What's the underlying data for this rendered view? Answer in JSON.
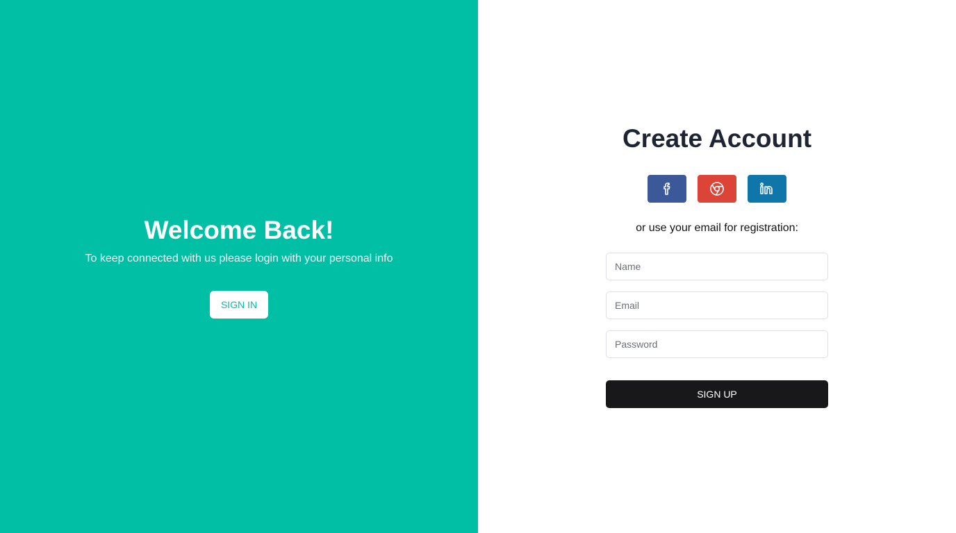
{
  "colors": {
    "left_panel_bg": "#00bfa5",
    "facebook": "#3b5998",
    "google": "#db4437",
    "linkedin": "#0e76a8",
    "signup_bg": "#18181b",
    "title_text": "#1f2433"
  },
  "left": {
    "title": "Welcome Back!",
    "subtitle": "To keep connected with us please login with your personal info",
    "signin_label": "SIGN IN"
  },
  "right": {
    "title": "Create Account",
    "social": [
      {
        "icon": "facebook-icon"
      },
      {
        "icon": "chrome-icon"
      },
      {
        "icon": "linkedin-icon"
      }
    ],
    "or_text": "or use your email for registration:",
    "name_placeholder": "Name",
    "email_placeholder": "Email",
    "password_placeholder": "Password",
    "signup_label": "SIGN UP"
  }
}
